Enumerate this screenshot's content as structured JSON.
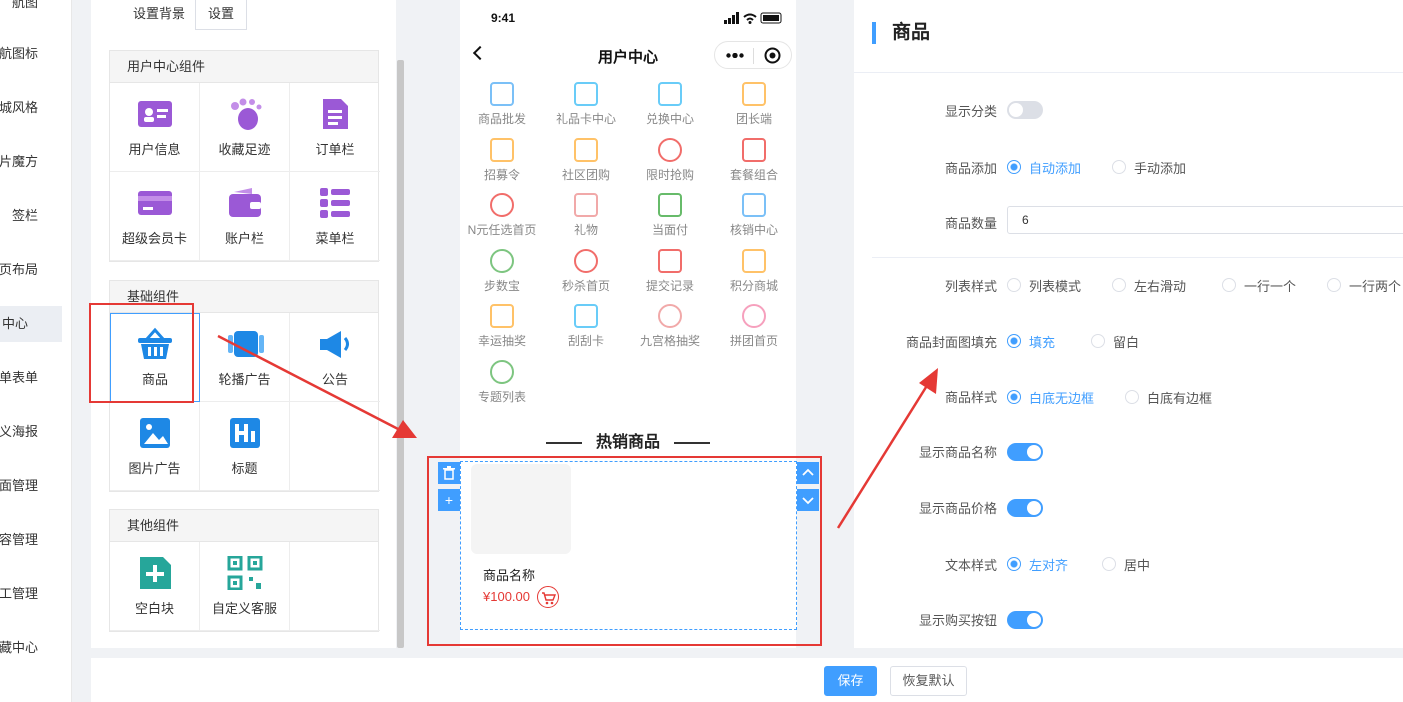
{
  "nav": {
    "items": [
      "航图",
      "航图标",
      "城风格",
      "片魔方",
      "签栏",
      "页布局",
      "户中心",
      "单表单",
      "定义海报",
      "面管理",
      "容管理",
      "工管理",
      "藏中心"
    ],
    "active_index": 6
  },
  "palette": {
    "tabs": [
      "设置背景",
      "设置"
    ],
    "groups": [
      {
        "title": "用户中心组件",
        "items": [
          "用户信息",
          "收藏足迹",
          "订单栏",
          "超级会员卡",
          "账户栏",
          "菜单栏"
        ]
      },
      {
        "title": "基础组件",
        "items": [
          "商品",
          "轮播广告",
          "公告",
          "图片广告",
          "标题"
        ]
      },
      {
        "title": "其他组件",
        "items": [
          "空白块",
          "自定义客服"
        ]
      }
    ]
  },
  "phone": {
    "time": "9:41",
    "title": "用户中心",
    "menu": [
      "商品批发",
      "礼品卡中心",
      "兑换中心",
      "团长端",
      "招募令",
      "社区团购",
      "限时抢购",
      "套餐组合",
      "N元任选首页",
      "礼物",
      "当面付",
      "核销中心",
      "步数宝",
      "秒杀首页",
      "提交记录",
      "积分商城",
      "幸运抽奖",
      "刮刮卡",
      "九宫格抽奖",
      "拼团首页",
      "专题列表"
    ],
    "section_title": "热销商品",
    "product": {
      "name": "商品名称",
      "price": "¥100.00"
    }
  },
  "panel": {
    "title": "商品",
    "show_category_label": "显示分类",
    "show_category_on": false,
    "add_label": "商品添加",
    "add_options": [
      "自动添加",
      "手动添加"
    ],
    "quantity_label": "商品数量",
    "quantity_value": "6",
    "list_style_label": "列表样式",
    "list_style_options": [
      "列表模式",
      "左右滑动",
      "一行一个",
      "一行两个"
    ],
    "cover_label": "商品封面图填充",
    "cover_options": [
      "填充",
      "留白"
    ],
    "style_label": "商品样式",
    "style_options": [
      "白底无边框",
      "白底有边框"
    ],
    "show_name_label": "显示商品名称",
    "show_price_label": "显示商品价格",
    "text_style_label": "文本样式",
    "text_style_options": [
      "左对齐",
      "居中"
    ],
    "show_buy_label": "显示购买按钮"
  },
  "footer": {
    "save": "保存",
    "reset": "恢复默认"
  },
  "colors": {
    "accent": "#409eff",
    "annotation": "#e53935"
  }
}
